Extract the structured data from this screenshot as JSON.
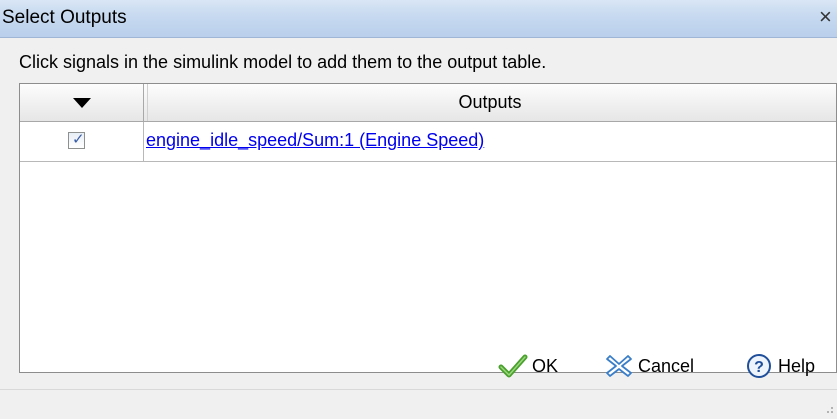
{
  "window": {
    "title": "Select Outputs",
    "close_symbol": "×"
  },
  "instruction": "Click signals in the simulink model to add them to the output table.",
  "table": {
    "columns": [
      "",
      "Outputs"
    ],
    "sort_icon": "sort-down-arrow-icon",
    "rows": [
      {
        "checked": true,
        "signal": "engine_idle_speed/Sum:1 (Engine Speed)"
      }
    ]
  },
  "buttons": {
    "ok_label": "OK",
    "cancel_label": "Cancel",
    "help_label": "Help"
  },
  "icons": {
    "ok": "checkmark-icon",
    "cancel": "x-cross-icon",
    "help": "question-mark-icon"
  },
  "colors": {
    "link": "#0000ee",
    "ok_icon": "#4aa02c",
    "cancel_icon": "#3b7ec8",
    "help_icon": "#1f4f9a"
  }
}
